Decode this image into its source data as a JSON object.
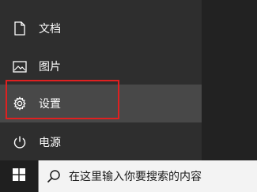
{
  "start_menu": {
    "items": [
      {
        "label": "文档",
        "icon": "document-icon"
      },
      {
        "label": "图片",
        "icon": "picture-icon"
      },
      {
        "label": "设置",
        "icon": "gear-icon"
      },
      {
        "label": "电源",
        "icon": "power-icon"
      }
    ]
  },
  "taskbar": {
    "search_placeholder": "在这里输入你要搜索的内容",
    "start_icon": "windows-logo-icon",
    "search_icon": "search-icon"
  },
  "colors": {
    "highlight_border": "#e02020",
    "menu_background": "#2e2e2e",
    "taskbar_background": "#1f1f1f",
    "search_background": "#f3f3f3"
  }
}
